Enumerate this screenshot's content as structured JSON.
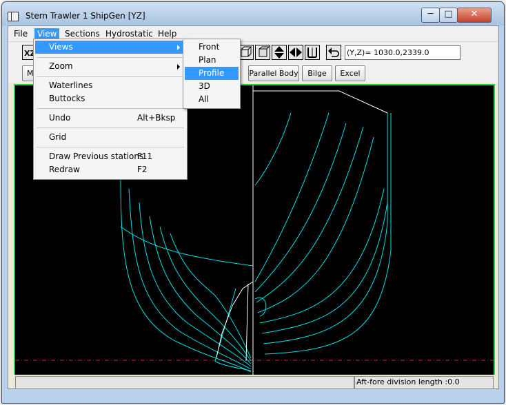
{
  "window": {
    "title": "Stern Trawler  1 ShipGen [YZ]",
    "min_glyph": "─",
    "max_glyph": "□",
    "close_glyph": "✕"
  },
  "menubar": {
    "items": [
      "File",
      "View",
      "Sections",
      "Hydrostatic",
      "Help"
    ],
    "active": "View"
  },
  "toolbar": {
    "coord_value": "(Y,Z)= 1030.0,2339.0"
  },
  "buttons": [
    "Ma",
    "Parallel Body",
    "Bilge",
    "Excel"
  ],
  "view_menu": {
    "items": [
      {
        "label": "Views",
        "shortcut": "",
        "submenu": true,
        "highlighted": true
      },
      {
        "label": "Zoom",
        "shortcut": "",
        "submenu": true,
        "highlighted": false
      },
      {
        "label": "Waterlines",
        "shortcut": ""
      },
      {
        "label": "Buttocks",
        "shortcut": ""
      },
      {
        "label": "Undo",
        "shortcut": "Alt+Bksp"
      },
      {
        "label": "Grid",
        "shortcut": ""
      },
      {
        "label": "Draw Previous stations",
        "shortcut": "F11"
      },
      {
        "label": "Redraw",
        "shortcut": "F2"
      }
    ]
  },
  "views_submenu": {
    "items": [
      "Front",
      "Plan",
      "Profile",
      "3D",
      "All"
    ],
    "highlighted": "Profile"
  },
  "status": {
    "right": "Aft-fore division length :0.0"
  },
  "colors": {
    "accent": "#3399ff",
    "hull_lines": "#00e5e5",
    "waterline": "#cc2222",
    "frame": "#2ecc40"
  }
}
